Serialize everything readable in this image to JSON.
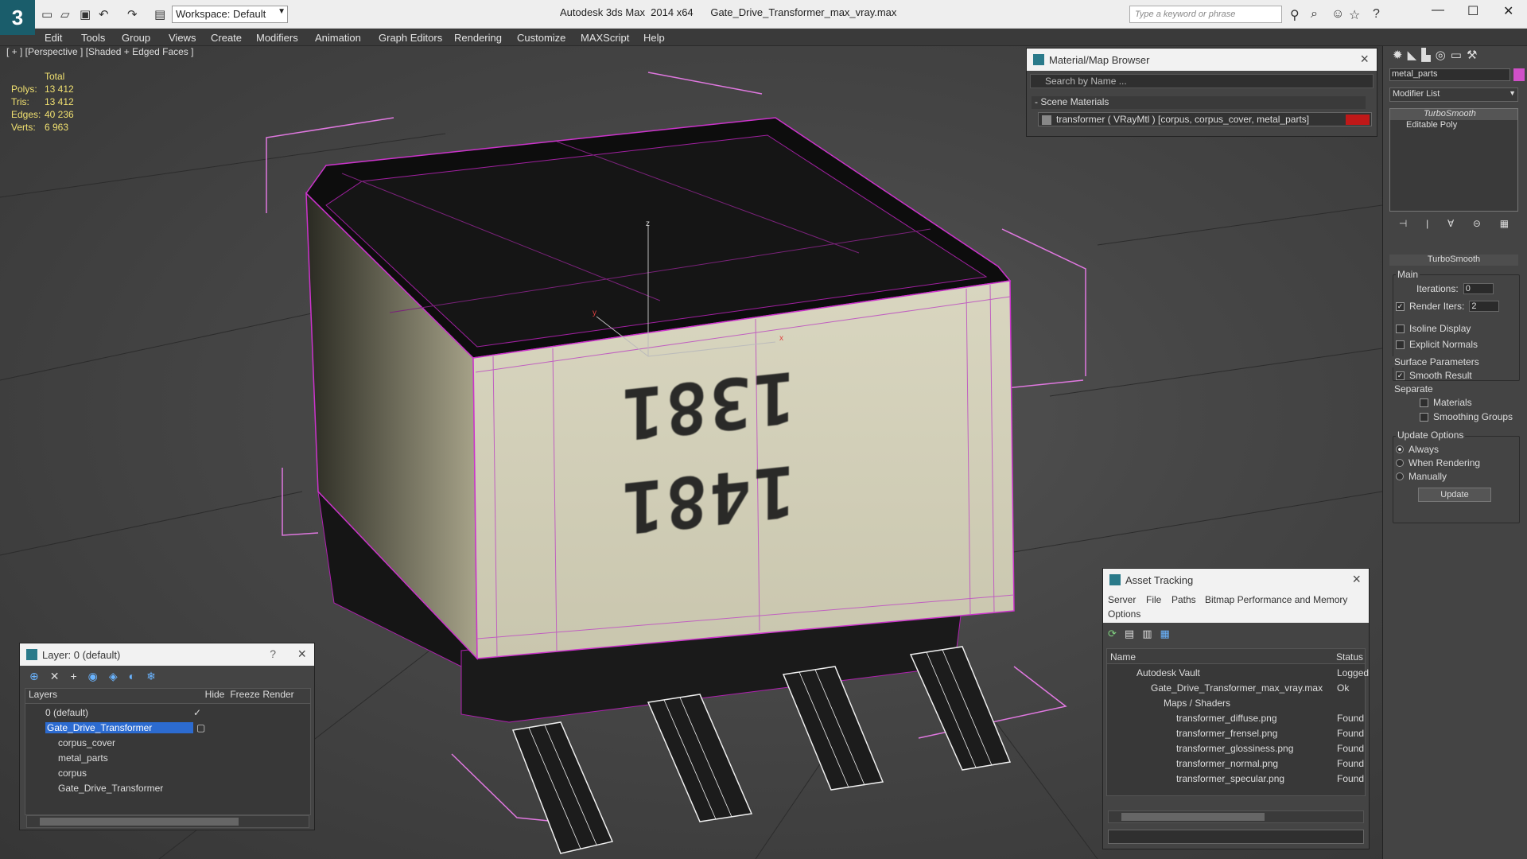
{
  "app": {
    "title": "Autodesk 3ds Max  2014 x64",
    "file": "Gate_Drive_Transformer_max_vray.max",
    "logo_text": "3",
    "workspace": "Workspace: Default",
    "search_placeholder": "Type a keyword or phrase"
  },
  "menu": [
    "Edit",
    "Tools",
    "Group",
    "Views",
    "Create",
    "Modifiers",
    "Animation",
    "Graph Editors",
    "Rendering",
    "Customize",
    "MAXScript",
    "Help"
  ],
  "viewport": {
    "label": "[ + ] [Perspective ] [Shaded + Edged Faces ]",
    "stats": {
      "header": "Total",
      "rows": [
        {
          "label": "Polys:",
          "value": "13 412"
        },
        {
          "label": "Tris:",
          "value": "13 412"
        },
        {
          "label": "Edges:",
          "value": "40 236"
        },
        {
          "label": "Verts:",
          "value": "6 963"
        }
      ]
    },
    "markings": [
      "1381",
      "1481"
    ],
    "axis": {
      "z": "z",
      "x": "x",
      "y": "y"
    }
  },
  "material_browser": {
    "title": "Material/Map Browser",
    "search_placeholder": "Search by Name ...",
    "group": "- Scene Materials",
    "item": "transformer  ( VRayMtl ) [corpus, corpus_cover, metal_parts]"
  },
  "command_panel": {
    "object_name": "metal_parts",
    "modifier_list": "Modifier List",
    "stack": [
      "TurboSmooth",
      "Editable Poly"
    ],
    "turbosmooth": {
      "title": "TurboSmooth",
      "main": "Main",
      "iterations_label": "Iterations:",
      "iterations": "0",
      "render_iters_label": "Render Iters:",
      "render_iters": "2",
      "isoline": "Isoline Display",
      "explicit": "Explicit Normals",
      "surface": "Surface Parameters",
      "smooth_result": "Smooth Result",
      "separate": "Separate",
      "materials": "Materials",
      "smoothing_groups": "Smoothing Groups",
      "update_options": "Update Options",
      "always": "Always",
      "when_rendering": "When Rendering",
      "manually": "Manually",
      "update_btn": "Update"
    }
  },
  "layer_panel": {
    "title": "Layer: 0 (default)",
    "help": "?",
    "columns": [
      "Layers",
      "Hide",
      "Freeze",
      "Render"
    ],
    "rows": [
      {
        "name": "0 (default)",
        "indent": 1
      },
      {
        "name": "Gate_Drive_Transformer",
        "indent": 1
      },
      {
        "name": "corpus_cover",
        "indent": 2
      },
      {
        "name": "metal_parts",
        "indent": 2
      },
      {
        "name": "corpus",
        "indent": 2
      },
      {
        "name": "Gate_Drive_Transformer",
        "indent": 2
      }
    ]
  },
  "asset_tracking": {
    "title": "Asset Tracking",
    "menu": [
      "Server",
      "File",
      "Paths",
      "Bitmap Performance and Memory"
    ],
    "menu2": "Options",
    "columns": [
      "Name",
      "Status"
    ],
    "rows": [
      {
        "name": "Autodesk Vault",
        "status": "Logged",
        "indent": 1
      },
      {
        "name": "Gate_Drive_Transformer_max_vray.max",
        "status": "Ok",
        "indent": 2
      },
      {
        "name": "Maps / Shaders",
        "status": "",
        "indent": 3
      },
      {
        "name": "transformer_diffuse.png",
        "status": "Found",
        "indent": 4
      },
      {
        "name": "transformer_frensel.png",
        "status": "Found",
        "indent": 4
      },
      {
        "name": "transformer_glossiness.png",
        "status": "Found",
        "indent": 4
      },
      {
        "name": "transformer_normal.png",
        "status": "Found",
        "indent": 4
      },
      {
        "name": "transformer_specular.png",
        "status": "Found",
        "indent": 4
      }
    ]
  },
  "colors": {
    "accent": "#cc33cc",
    "selection": "#2c6bd0",
    "ui_bg": "#444444"
  },
  "icons": [
    "new-file-icon",
    "open-icon",
    "save-icon",
    "undo-icon",
    "redo-icon",
    "close-icon",
    "search-icon",
    "help-icon"
  ]
}
